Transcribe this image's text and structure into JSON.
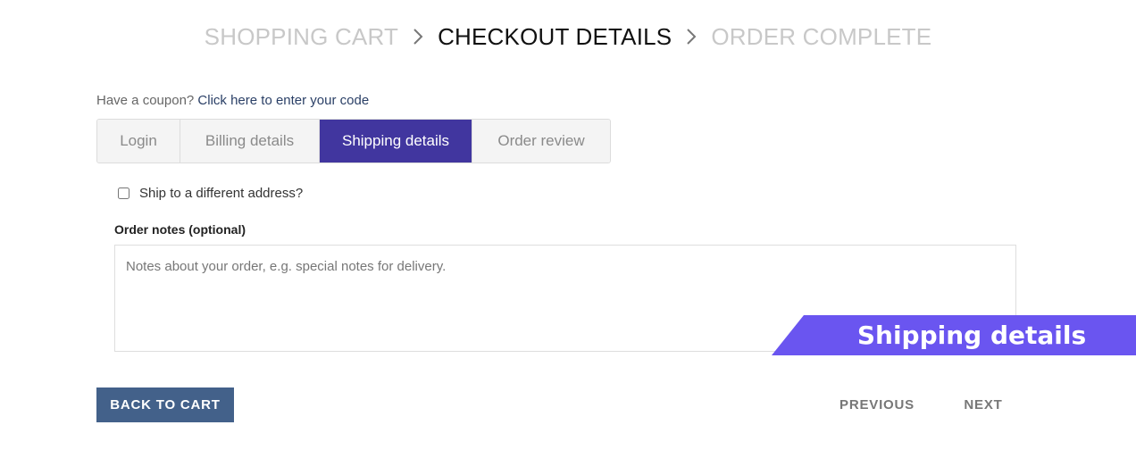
{
  "steps": {
    "shopping_cart": "SHOPPING CART",
    "checkout_details": "CHECKOUT DETAILS",
    "order_complete": "ORDER COMPLETE"
  },
  "coupon": {
    "prompt": "Have a coupon?",
    "link": "Click here to enter your code"
  },
  "tabs": [
    {
      "label": "Login"
    },
    {
      "label": "Billing details"
    },
    {
      "label": "Shipping details",
      "active": true
    },
    {
      "label": "Order review"
    }
  ],
  "shipping": {
    "different_address_label": "Ship to a different address?",
    "notes_label": "Order notes (optional)",
    "notes_placeholder": "Notes about your order, e.g. special notes for delivery.",
    "notes_value": ""
  },
  "ribbon": {
    "text": "Shipping details",
    "color": "#6a55f0"
  },
  "buttons": {
    "back": "BACK TO CART",
    "previous": "PREVIOUS",
    "next": "NEXT"
  },
  "colors": {
    "active_tab": "#41369f",
    "back_button": "#43618a",
    "link": "#2a3f66"
  },
  "icons": {
    "step_separator": "chevron-right-icon"
  }
}
